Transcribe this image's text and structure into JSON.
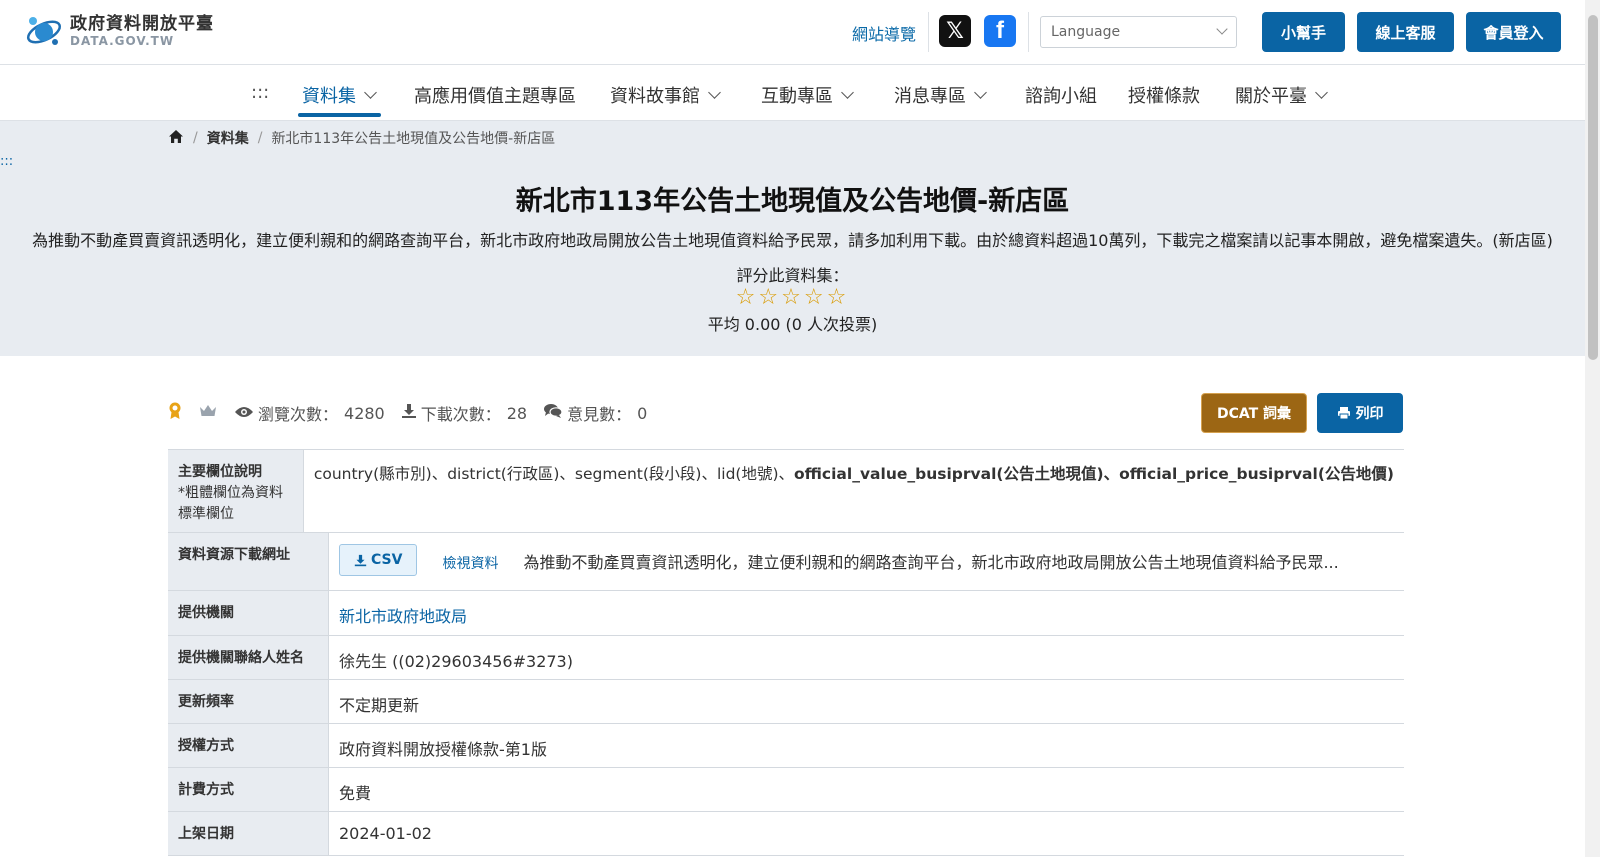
{
  "header": {
    "logo_cn": "政府資料開放平臺",
    "logo_en": "DATA.GOV.TW",
    "sitemap": "網站導覽",
    "language_placeholder": "Language",
    "help_btn": "小幫手",
    "service_btn": "線上客服",
    "login_btn": "會員登入",
    "social": [
      "x-icon",
      "facebook-icon"
    ]
  },
  "nav": {
    "accesskey": ":::",
    "items": [
      {
        "label": "資料集",
        "dropdown": true,
        "active": true
      },
      {
        "label": "高應用價值主題專區",
        "dropdown": false
      },
      {
        "label": "資料故事館",
        "dropdown": true
      },
      {
        "label": "互動專區",
        "dropdown": true
      },
      {
        "label": "消息專區",
        "dropdown": true
      },
      {
        "label": "諮詢小組",
        "dropdown": false
      },
      {
        "label": "授權條款",
        "dropdown": false
      },
      {
        "label": "關於平臺",
        "dropdown": true
      }
    ]
  },
  "breadcrumb": {
    "level1": "資料集",
    "current": "新北市113年公告土地現值及公告地價-新店區"
  },
  "hero": {
    "accesskey": ":::",
    "title": "新北市113年公告土地現值及公告地價-新店區",
    "description": "為推動不動產買賣資訊透明化，建立便利親和的網路查詢平台，新北市政府地政局開放公告土地現值資料給予民眾，請多加利用下載。由於總資料超過10萬列，下載完之檔案請以記事本開啟，避免檔案遺失。(新店區)",
    "rating_label": "評分此資料集：",
    "stars_filled": 0,
    "stars_total": 5,
    "average": "平均 0.00 (0 人次投票)"
  },
  "stats": {
    "views_label": "瀏覽次數：",
    "views": "4280",
    "downloads_label": "下載次數：",
    "downloads": "28",
    "comments_label": "意見數：",
    "comments": "0",
    "dcat_btn": "DCAT 詞彙",
    "print_btn": "列印"
  },
  "table": {
    "fields_label": "主要欄位說明",
    "fields_note": "*粗體欄位為資料標準欄位",
    "fields_normal": "country(縣市別)、district(行政區)、segment(段小段)、lid(地號)、",
    "fields_bold": "official_value_busiprval(公告土地現值)、official_price_busiprval(公告地價)",
    "download_label": "資料資源下載網址",
    "csv_btn": "CSV",
    "view_link": "檢視資料",
    "resource_desc": "為推動不動產買賣資訊透明化，建立便利親和的網路查詢平台，新北市政府地政局開放公告土地現值資料給予民眾...",
    "agency_label": "提供機關",
    "agency": "新北市政府地政局",
    "contact_label": "提供機關聯絡人姓名",
    "contact": "徐先生 ((02)29603456#3273)",
    "frequency_label": "更新頻率",
    "frequency": "不定期更新",
    "license_label": "授權方式",
    "license": "政府資料開放授權條款-第1版",
    "fee_label": "計費方式",
    "fee": "免費",
    "date_label": "上架日期",
    "date": "2024-01-02"
  },
  "colors": {
    "primary": "#0a64a4",
    "dcat": "#9c6614",
    "hero_bg": "#e8ecf1",
    "star": "#d99a00"
  }
}
